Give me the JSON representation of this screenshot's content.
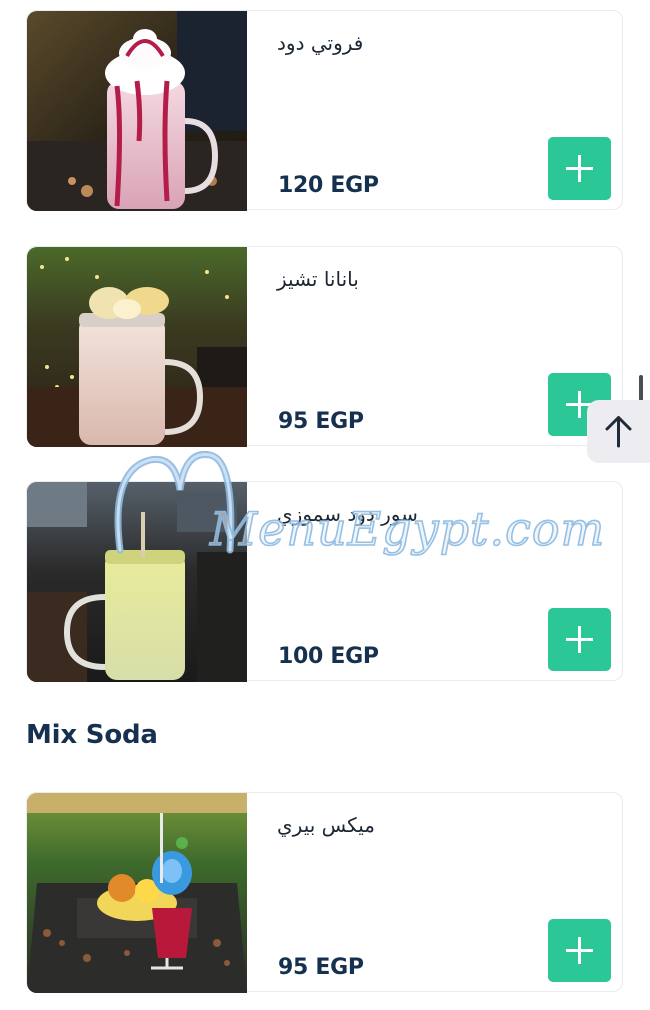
{
  "menu_items": [
    {
      "name": "فروتي دود",
      "price": "120 EGP",
      "image_icon": "strawberry-milkshake-image",
      "add_icon": "plus-icon"
    },
    {
      "name": "بانانا تشيز",
      "price": "95 EGP",
      "image_icon": "banana-shake-image",
      "add_icon": "plus-icon"
    },
    {
      "name": "سور دود سموزي",
      "price": "100 EGP",
      "image_icon": "lime-smoothie-image",
      "add_icon": "plus-icon"
    },
    {
      "name": "ميكس بيري",
      "price": "95 EGP",
      "image_icon": "mixed-berry-soda-image",
      "add_icon": "plus-icon"
    }
  ],
  "sections": {
    "mix_soda": "Mix Soda"
  },
  "watermark": {
    "text": "MenuEgypt.com"
  },
  "scroll_top": {
    "icon": "arrow-up-icon"
  },
  "colors": {
    "accent": "#2cc796",
    "price_text": "#16314f",
    "card_border": "#e8ebef",
    "scroll_top_bg": "#ececf1"
  }
}
